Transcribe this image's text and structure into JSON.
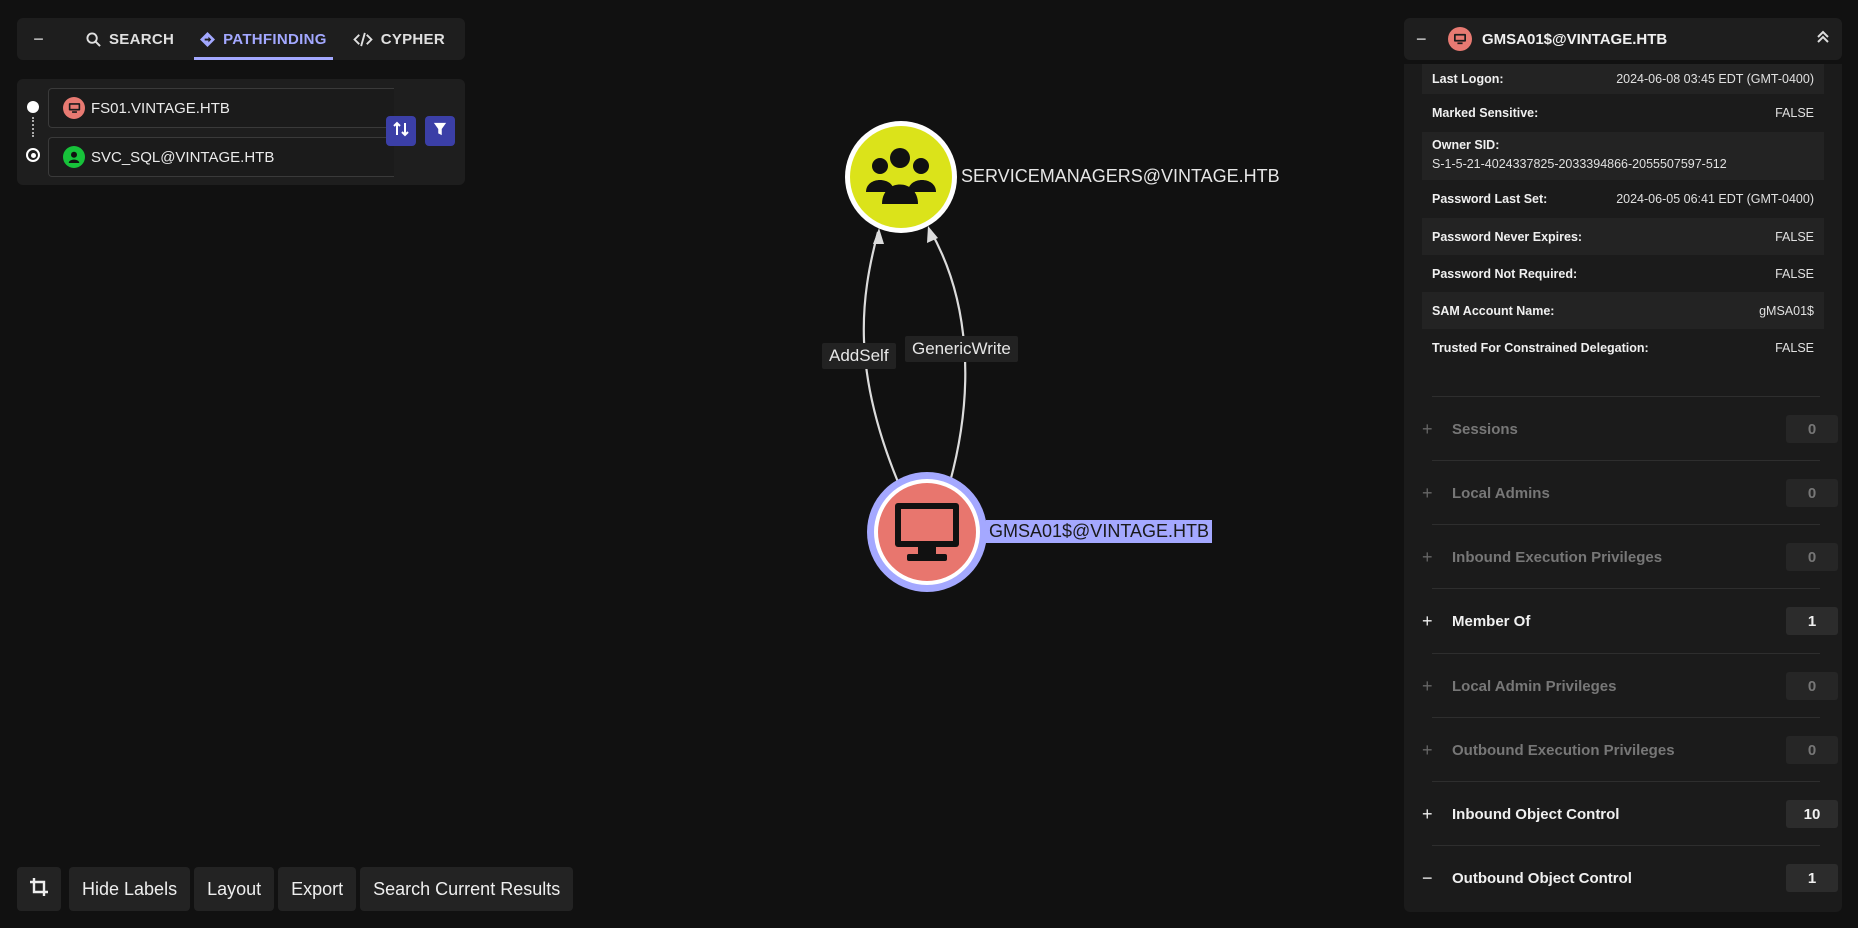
{
  "tabs": {
    "collapse_symbol": "−",
    "items": [
      {
        "label": "SEARCH",
        "icon": "search-icon"
      },
      {
        "label": "PATHFINDING",
        "icon": "pathfinding-icon"
      },
      {
        "label": "CYPHER",
        "icon": "code-icon"
      }
    ],
    "active": "PATHFINDING"
  },
  "pathfinding": {
    "start_node": "FS01.VINTAGE.HTB",
    "end_node": "SVC_SQL@VINTAGE.HTB"
  },
  "graph": {
    "nodes": [
      {
        "label": "SERVICEMANAGERS@VINTAGE.HTB",
        "kind": "group",
        "color": "#dbe31a"
      },
      {
        "label": "GMSA01$@VINTAGE.HTB",
        "kind": "computer",
        "color": "#e8766e",
        "selected": true
      }
    ],
    "edges": [
      {
        "label": "AddSelf",
        "from": "GMSA01$@VINTAGE.HTB",
        "to": "SERVICEMANAGERS@VINTAGE.HTB"
      },
      {
        "label": "GenericWrite",
        "from": "GMSA01$@VINTAGE.HTB",
        "to": "SERVICEMANAGERS@VINTAGE.HTB"
      }
    ],
    "selection_color": "#a4a8ff"
  },
  "bottom_bar": {
    "hide_labels": "Hide Labels",
    "layout": "Layout",
    "export": "Export",
    "search_results": "Search Current Results"
  },
  "panel": {
    "collapse_symbol": "−",
    "title": "GMSA01$@VINTAGE.HTB",
    "properties": [
      {
        "key": "Last Logon:",
        "value": "2024-06-08 03:45 EDT (GMT-0400)"
      },
      {
        "key": "Marked Sensitive:",
        "value": "FALSE"
      },
      {
        "key": "Owner SID:",
        "value": "S-1-5-21-4024337825-2033394866-2055507597-512"
      },
      {
        "key": "Password Last Set:",
        "value": "2024-06-05 06:41 EDT (GMT-0400)"
      },
      {
        "key": "Password Never Expires:",
        "value": "FALSE"
      },
      {
        "key": "Password Not Required:",
        "value": "FALSE"
      },
      {
        "key": "SAM Account Name:",
        "value": "gMSA01$"
      },
      {
        "key": "Trusted For Constrained Delegation:",
        "value": "FALSE"
      }
    ],
    "sections": [
      {
        "name": "Sessions",
        "count": "0",
        "toggle": "+",
        "enabled": false
      },
      {
        "name": "Local Admins",
        "count": "0",
        "toggle": "+",
        "enabled": false
      },
      {
        "name": "Inbound Execution Privileges",
        "count": "0",
        "toggle": "+",
        "enabled": false
      },
      {
        "name": "Member Of",
        "count": "1",
        "toggle": "+",
        "enabled": true
      },
      {
        "name": "Local Admin Privileges",
        "count": "0",
        "toggle": "+",
        "enabled": false
      },
      {
        "name": "Outbound Execution Privileges",
        "count": "0",
        "toggle": "+",
        "enabled": false
      },
      {
        "name": "Inbound Object Control",
        "count": "10",
        "toggle": "+",
        "enabled": true
      },
      {
        "name": "Outbound Object Control",
        "count": "1",
        "toggle": "−",
        "enabled": true
      }
    ]
  }
}
